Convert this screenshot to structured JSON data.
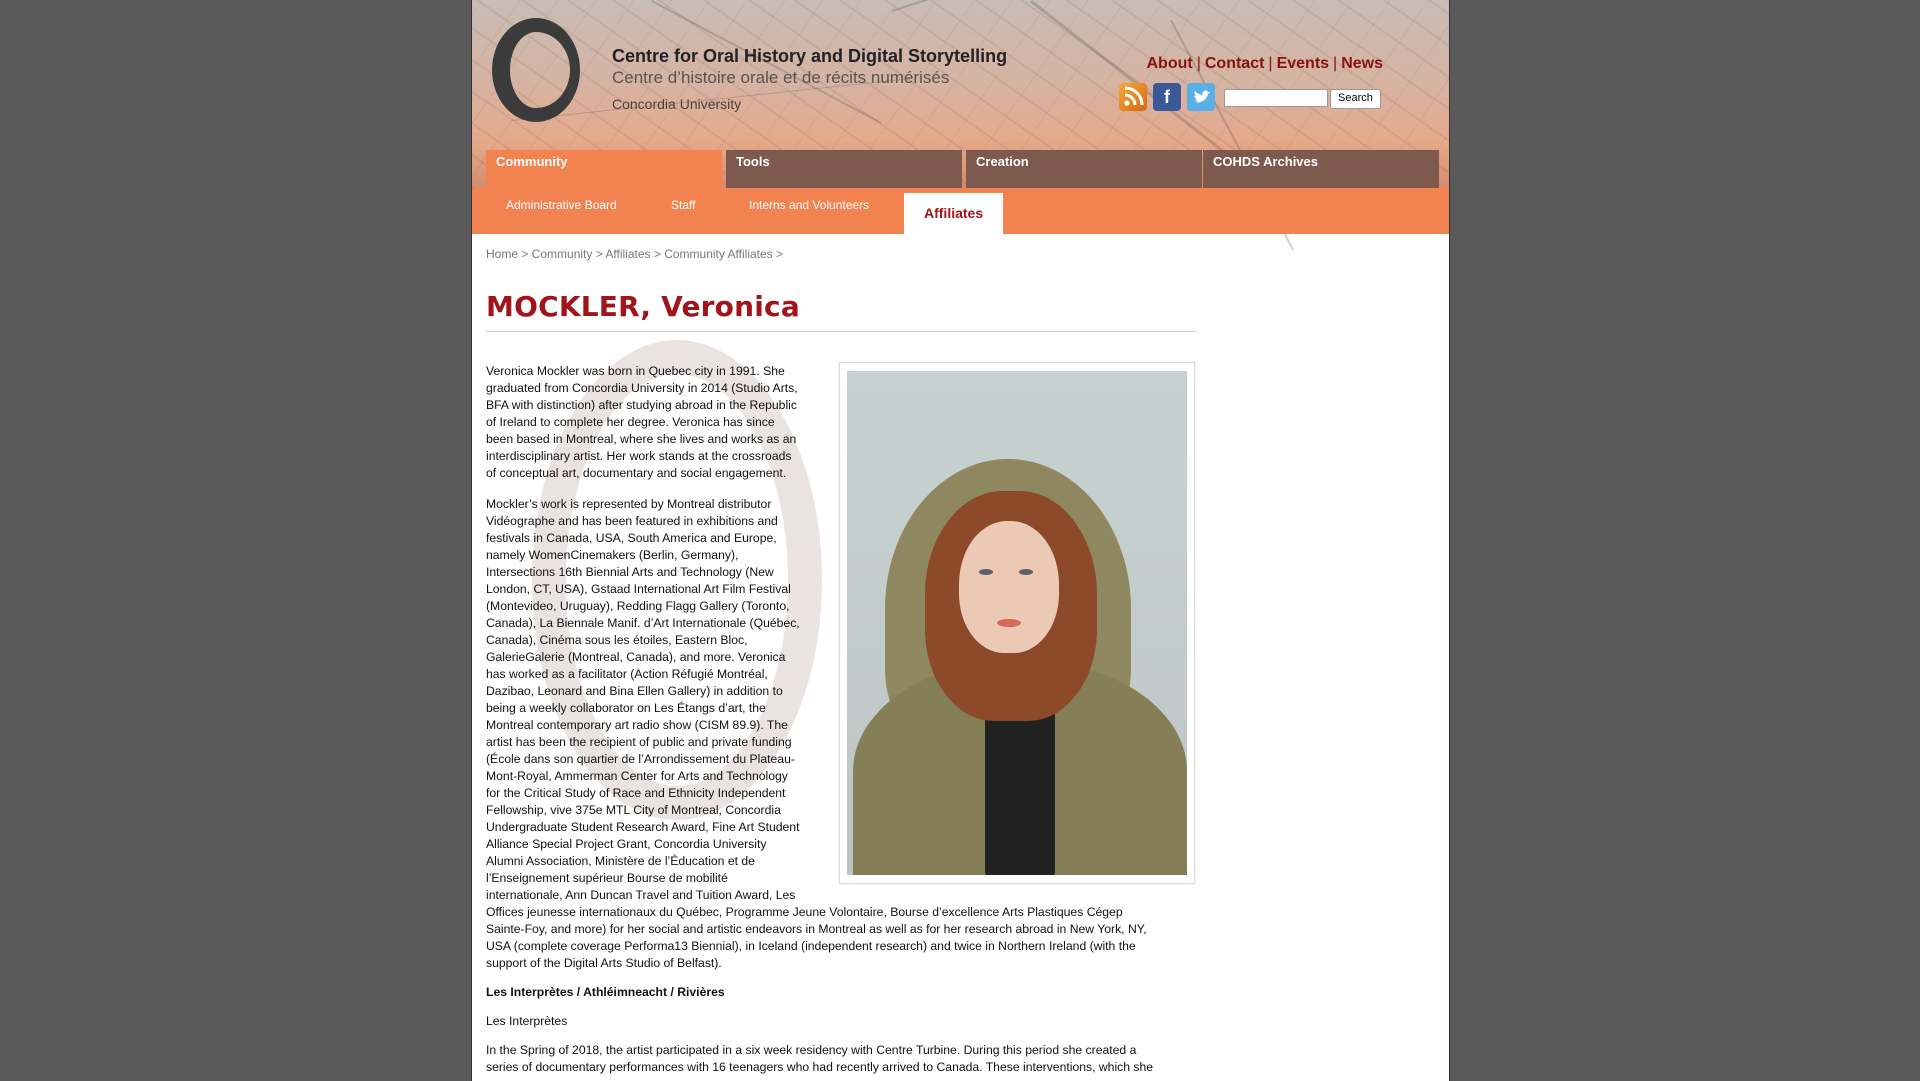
{
  "header": {
    "title_en": "Centre for Oral History and Digital Storytelling",
    "title_fr": "Centre d’histoire orale et de récits numérisés",
    "university": "Concordia University",
    "links": [
      "About",
      "Contact",
      "Events",
      "News"
    ],
    "social_icons": [
      "rss-icon",
      "facebook-icon",
      "twitter-icon"
    ],
    "search": {
      "value": "",
      "button_label": "Search"
    }
  },
  "nav": {
    "tabs": [
      {
        "label": "Community",
        "active": true
      },
      {
        "label": "Tools",
        "active": false
      },
      {
        "label": "Creation",
        "active": false
      },
      {
        "label": "COHDS Archives",
        "active": false
      }
    ],
    "subtabs": [
      {
        "label": "Administrative Board",
        "active": false
      },
      {
        "label": "Staff",
        "active": false
      },
      {
        "label": "Interns and Volunteers",
        "active": false
      },
      {
        "label": "Affiliates",
        "active": true
      }
    ]
  },
  "breadcrumb": "Home > Community > Affiliates > Community Affiliates >",
  "page_title": "MOCKLER, Veronica",
  "content": {
    "para1_lines": [
      "Veronica Mockler was born in Quebec city in 1991. She",
      "graduated from Concordia University in 2014 (Studio Arts,",
      "BFA with distinction) after studying abroad in the Republic",
      "of Ireland to complete her degree. Veronica has since",
      "been based in Montreal, where she lives and works as an",
      "interdisciplinary artist. Her work stands at the crossroads",
      "of conceptual art, documentary and social engagement."
    ],
    "para2_lines": [
      "Mockler’s work is represented by Montreal distributor",
      "Vidéographe and has been featured in exhibitions and",
      "festivals in Canada, USA, South America and Europe,",
      "namely WomenCinemakers (Berlin, Germany),",
      "Intersections 16th Biennial Arts and Technology (New",
      "London, CT, USA), Gstaad International Art Film Festival",
      "(Montevideo, Uruguay), Redding Flagg Gallery (Toronto,",
      "Canada), La Biennale Manif. d’Art Internationale (Québec,",
      "Canada), Cinéma sous les étoiles, Eastern Bloc,",
      "GalerieGalerie (Montreal, Canada), and more. Veronica",
      "has worked as a facilitator (Action Réfugié Montréal,",
      "Dazibao, Leonard and Bina Ellen Gallery) in addition to",
      "being a weekly collaborator on Les Étangs d’art, the",
      "Montreal contemporary art radio show (CISM 89.9). The",
      "artist has been the recipient of public and private funding",
      "(École dans son quartier de l’Arrondissement du Plateau-",
      "Mont-Royal, Ammerman Center for Arts and Technology",
      "for the Critical Study of Race and Ethnicity Independent",
      "Fellowship, vive 375e MTL City of Montreal, Concordia",
      "Undergraduate Student Research Award, Fine Art Student",
      "Alliance Special Project Grant, Concordia University",
      "Alumni Association, Ministère de l’Éducation et de",
      "l’Enseignement supérieur Bourse de mobilité",
      "internationale, Ann Duncan Travel and Tuition Award, Les"
    ],
    "para2_wide_lines": [
      "Offices jeunesse internationaux du Québec, Programme Jeune Volontaire, Bourse d’excellence Arts Plastiques Cégep",
      "Sainte-Foy, and more) for her social and artistic endeavors in Montreal as well as for her research abroad in New York, NY,",
      "USA (complete coverage Performa13 Biennial), in Iceland (independent research) and twice in Northern Ireland (with the",
      "support of the Digital Arts Studio of Belfast)."
    ],
    "subheading": "Les Interprètes / Athléimneacht / Rivières",
    "subheading2": "Les Interprètes",
    "para3_lines": [
      "In the Spring of 2018, the artist participated in a six week residency with Centre Turbine. During this period she created a",
      "series of documentary performances with 16 teenagers who had recently arrived to Canada. These interventions, which she"
    ]
  }
}
